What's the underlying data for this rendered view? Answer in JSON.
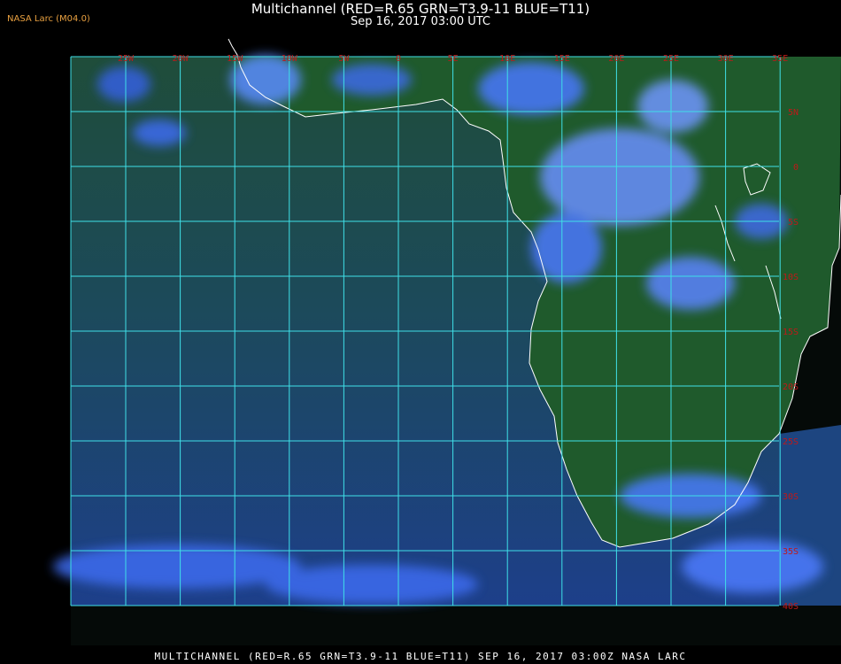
{
  "header": {
    "badge": "NASA Larc (M04.0)",
    "title": "Multichannel (RED=R.65 GRN=T3.9-11 BLUE=T11)",
    "subtitle": "Sep 16, 2017 03:00 UTC"
  },
  "footer": {
    "caption": "MULTICHANNEL (RED=R.65 GRN=T3.9-11 BLUE=T11) SEP 16, 2017 03:00Z   NASA LARC"
  },
  "map": {
    "grid_color": "#3fe0e8",
    "coast_color": "#ffffff",
    "label_color": "#c01818",
    "ocean_color": "#1a3d6b",
    "land_color": "#1e5a2a",
    "cloud_color": "#3c78ff",
    "lon_labels": [
      "25W",
      "20W",
      "15W",
      "10W",
      "5W",
      "0",
      "5E",
      "10E",
      "15E",
      "20E",
      "25E",
      "30E",
      "35E"
    ],
    "lat_labels": [
      "5N",
      "0",
      "5S",
      "10S",
      "15S",
      "20S",
      "25S",
      "30S",
      "35S",
      "40S"
    ]
  }
}
